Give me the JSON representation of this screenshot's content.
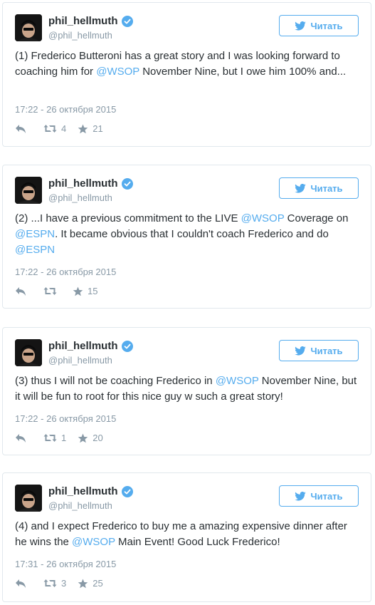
{
  "tweets": [
    {
      "name": "phil_hellmuth",
      "handle": "@phil_hellmuth",
      "follow_label": "Читать",
      "segments": [
        {
          "t": "(1) Frederico Butteroni has a great story and I was looking forward to coaching him for "
        },
        {
          "m": "@WSOP"
        },
        {
          "t": " November Nine, but I owe him 100% and..."
        }
      ],
      "timestamp": "17:22 - 26 октября 2015",
      "retweets": "4",
      "favorites": "21"
    },
    {
      "name": "phil_hellmuth",
      "handle": "@phil_hellmuth",
      "follow_label": "Читать",
      "segments": [
        {
          "t": "(2) ...I have a previous commitment to the LIVE "
        },
        {
          "m": "@WSOP"
        },
        {
          "t": " Coverage on "
        },
        {
          "m": "@ESPN"
        },
        {
          "t": ".  It became obvious that I couldn't coach Frederico and do "
        },
        {
          "m": "@ESPN"
        }
      ],
      "timestamp": "17:22 - 26 октября 2015",
      "retweets": "",
      "favorites": "15"
    },
    {
      "name": "phil_hellmuth",
      "handle": "@phil_hellmuth",
      "follow_label": "Читать",
      "segments": [
        {
          "t": "(3) thus I will not be coaching Frederico in "
        },
        {
          "m": "@WSOP"
        },
        {
          "t": " November Nine, but it will be fun to root for this nice guy w such a great story!"
        }
      ],
      "timestamp": "17:22 - 26 октября 2015",
      "retweets": "1",
      "favorites": "20"
    },
    {
      "name": "phil_hellmuth",
      "handle": "@phil_hellmuth",
      "follow_label": "Читать",
      "segments": [
        {
          "t": "(4) and I expect Frederico to buy me a amazing expensive dinner after he wins the "
        },
        {
          "m": "@WSOP"
        },
        {
          "t": " Main Event!  Good Luck Frederico!"
        }
      ],
      "timestamp": "17:31 - 26 октября 2015",
      "retweets": "3",
      "favorites": "25"
    }
  ],
  "icons": {
    "verified": "verified-badge-icon",
    "bird": "twitter-bird-icon",
    "reply": "reply-icon",
    "retweet": "retweet-icon",
    "favorite": "star-icon"
  },
  "colors": {
    "accent": "#55acee",
    "muted": "#8899a6",
    "text": "#292f33",
    "border": "#e1e8ed"
  }
}
